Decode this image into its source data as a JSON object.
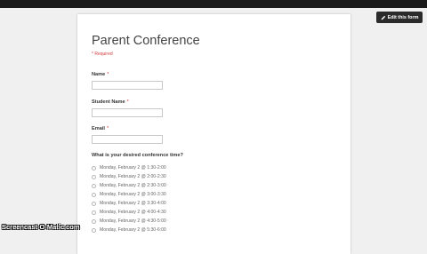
{
  "header": {
    "edit_button_label": "Edit this form",
    "edit_icon": "pencil-icon"
  },
  "form": {
    "title": "Parent Conference",
    "required_note": "* Required",
    "fields": [
      {
        "label": "Name",
        "required_mark": "*",
        "value": ""
      },
      {
        "label": "Student Name",
        "required_mark": "*",
        "value": ""
      },
      {
        "label": "Email",
        "required_mark": "*",
        "value": ""
      }
    ],
    "question": {
      "label": "What is your desired conference time?",
      "options": [
        "Monday, February 2 @ 1:30-2:00",
        "Monday, February 2 @ 2:00-2:30",
        "Monday, February 2 @ 2:30-3:00",
        "Monday, February 2 @ 3:00-3:30",
        "Monday, February 2 @ 3:30-4:00",
        "Monday, February 2 @ 4:00-4:30",
        "Monday, February 2 @ 4:30-5:00",
        "Monday, February 2 @ 5:30-6:00"
      ]
    }
  },
  "watermark": "Screencast-O-Matic.com",
  "colors": {
    "required": "#d33b3b",
    "edit_button_bg": "#2b2b2b",
    "background": "#f0f0f0"
  }
}
